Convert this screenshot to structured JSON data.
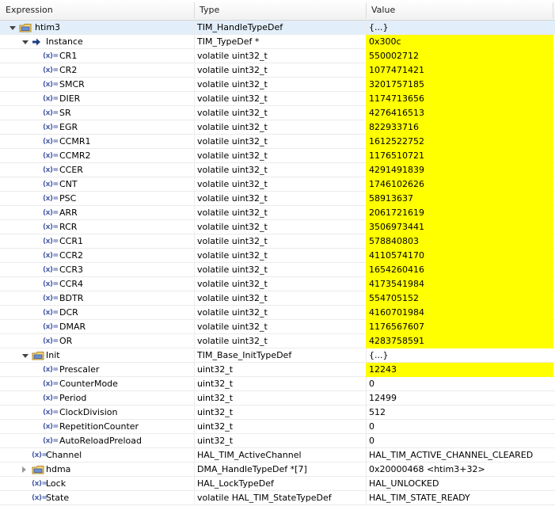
{
  "columns": {
    "expression": "Expression",
    "type": "Type",
    "value": "Value"
  },
  "icon_labels": {
    "variable": "(x)="
  },
  "colors": {
    "highlight": "#ffff00",
    "selected_row": "#e2eef9",
    "icon_blue": "#4a5ea8"
  },
  "rows": [
    {
      "name": "htim3",
      "type": "TIM_HandleTypeDef",
      "value": "{...}",
      "level": 0,
      "icon": "struct-icon",
      "expand": "expanded",
      "highlight": false,
      "selected": true
    },
    {
      "name": "Instance",
      "type": "TIM_TypeDef *",
      "value": "0x300c",
      "level": 1,
      "icon": "pointer-arrow-icon",
      "expand": "expanded",
      "highlight": true
    },
    {
      "name": "CR1",
      "type": "volatile uint32_t",
      "value": "550002712",
      "level": 2,
      "icon": "variable-icon",
      "highlight": true
    },
    {
      "name": "CR2",
      "type": "volatile uint32_t",
      "value": "1077471421",
      "level": 2,
      "icon": "variable-icon",
      "highlight": true
    },
    {
      "name": "SMCR",
      "type": "volatile uint32_t",
      "value": "3201757185",
      "level": 2,
      "icon": "variable-icon",
      "highlight": true
    },
    {
      "name": "DIER",
      "type": "volatile uint32_t",
      "value": "1174713656",
      "level": 2,
      "icon": "variable-icon",
      "highlight": true
    },
    {
      "name": "SR",
      "type": "volatile uint32_t",
      "value": "4276416513",
      "level": 2,
      "icon": "variable-icon",
      "highlight": true
    },
    {
      "name": "EGR",
      "type": "volatile uint32_t",
      "value": "822933716",
      "level": 2,
      "icon": "variable-icon",
      "highlight": true
    },
    {
      "name": "CCMR1",
      "type": "volatile uint32_t",
      "value": "1612522752",
      "level": 2,
      "icon": "variable-icon",
      "highlight": true
    },
    {
      "name": "CCMR2",
      "type": "volatile uint32_t",
      "value": "1176510721",
      "level": 2,
      "icon": "variable-icon",
      "highlight": true
    },
    {
      "name": "CCER",
      "type": "volatile uint32_t",
      "value": "4291491839",
      "level": 2,
      "icon": "variable-icon",
      "highlight": true
    },
    {
      "name": "CNT",
      "type": "volatile uint32_t",
      "value": "1746102626",
      "level": 2,
      "icon": "variable-icon",
      "highlight": true
    },
    {
      "name": "PSC",
      "type": "volatile uint32_t",
      "value": "58913637",
      "level": 2,
      "icon": "variable-icon",
      "highlight": true
    },
    {
      "name": "ARR",
      "type": "volatile uint32_t",
      "value": "2061721619",
      "level": 2,
      "icon": "variable-icon",
      "highlight": true
    },
    {
      "name": "RCR",
      "type": "volatile uint32_t",
      "value": "3506973441",
      "level": 2,
      "icon": "variable-icon",
      "highlight": true
    },
    {
      "name": "CCR1",
      "type": "volatile uint32_t",
      "value": "578840803",
      "level": 2,
      "icon": "variable-icon",
      "highlight": true
    },
    {
      "name": "CCR2",
      "type": "volatile uint32_t",
      "value": "4110574170",
      "level": 2,
      "icon": "variable-icon",
      "highlight": true
    },
    {
      "name": "CCR3",
      "type": "volatile uint32_t",
      "value": "1654260416",
      "level": 2,
      "icon": "variable-icon",
      "highlight": true
    },
    {
      "name": "CCR4",
      "type": "volatile uint32_t",
      "value": "4173541984",
      "level": 2,
      "icon": "variable-icon",
      "highlight": true
    },
    {
      "name": "BDTR",
      "type": "volatile uint32_t",
      "value": "554705152",
      "level": 2,
      "icon": "variable-icon",
      "highlight": true
    },
    {
      "name": "DCR",
      "type": "volatile uint32_t",
      "value": "4160701984",
      "level": 2,
      "icon": "variable-icon",
      "highlight": true
    },
    {
      "name": "DMAR",
      "type": "volatile uint32_t",
      "value": "1176567607",
      "level": 2,
      "icon": "variable-icon",
      "highlight": true
    },
    {
      "name": "OR",
      "type": "volatile uint32_t",
      "value": "4283758591",
      "level": 2,
      "icon": "variable-icon",
      "highlight": true
    },
    {
      "name": "Init",
      "type": "TIM_Base_InitTypeDef",
      "value": "{...}",
      "level": 1,
      "icon": "struct-icon",
      "expand": "expanded",
      "highlight": false
    },
    {
      "name": "Prescaler",
      "type": "uint32_t",
      "value": "12243",
      "level": 2,
      "icon": "variable-icon",
      "highlight": true
    },
    {
      "name": "CounterMode",
      "type": "uint32_t",
      "value": "0",
      "level": 2,
      "icon": "variable-icon",
      "highlight": false
    },
    {
      "name": "Period",
      "type": "uint32_t",
      "value": "12499",
      "level": 2,
      "icon": "variable-icon",
      "highlight": false
    },
    {
      "name": "ClockDivision",
      "type": "uint32_t",
      "value": "512",
      "level": 2,
      "icon": "variable-icon",
      "highlight": false
    },
    {
      "name": "RepetitionCounter",
      "type": "uint32_t",
      "value": "0",
      "level": 2,
      "icon": "variable-icon",
      "highlight": false
    },
    {
      "name": "AutoReloadPreload",
      "type": "uint32_t",
      "value": "0",
      "level": 2,
      "icon": "variable-icon",
      "highlight": false
    },
    {
      "name": "Channel",
      "type": "HAL_TIM_ActiveChannel",
      "value": "HAL_TIM_ACTIVE_CHANNEL_CLEARED",
      "level": 1,
      "icon": "variable-icon",
      "highlight": false
    },
    {
      "name": "hdma",
      "type": "DMA_HandleTypeDef *[7]",
      "value": "0x20000468 <htim3+32>",
      "level": 1,
      "icon": "struct-icon",
      "expand": "collapsed",
      "highlight": false
    },
    {
      "name": "Lock",
      "type": "HAL_LockTypeDef",
      "value": "HAL_UNLOCKED",
      "level": 1,
      "icon": "variable-icon",
      "highlight": false
    },
    {
      "name": "State",
      "type": "volatile HAL_TIM_StateTypeDef",
      "value": "HAL_TIM_STATE_READY",
      "level": 1,
      "icon": "variable-icon",
      "highlight": false
    }
  ]
}
